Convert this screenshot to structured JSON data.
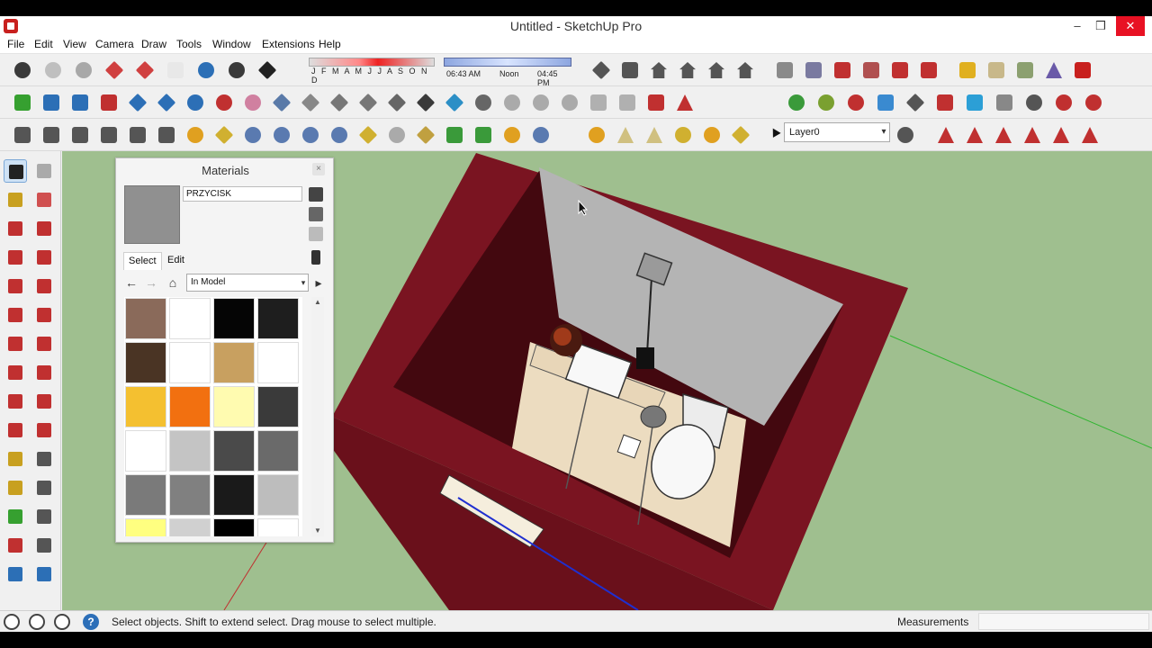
{
  "app": {
    "title": "Untitled - SketchUp Pro",
    "window_buttons": {
      "minimize": "–",
      "maximize": "❒",
      "close": "✕"
    },
    "accent_color": "#c8201e"
  },
  "menu": [
    "File",
    "Edit",
    "View",
    "Camera",
    "Draw",
    "Tools",
    "Window",
    "Extensions",
    "Help"
  ],
  "toolbar1": {
    "icons": [
      {
        "name": "get-started-icon",
        "color": "#3a3a3a",
        "shape": "circle"
      },
      {
        "name": "xray-icon",
        "color": "#bfbfbf",
        "shape": "circle"
      },
      {
        "name": "back-edges-icon",
        "color": "#a8a8a8",
        "shape": "circle"
      },
      {
        "name": "wireframe-icon",
        "color": "#d04040",
        "shape": "diamond"
      },
      {
        "name": "hidden-line-icon",
        "color": "#d04040",
        "shape": "diamond"
      },
      {
        "name": "shaded-icon",
        "color": "#e8e8e8",
        "shape": "square"
      },
      {
        "name": "shaded-with-textures-icon",
        "color": "#2c6fb6",
        "shape": "circle"
      },
      {
        "name": "monochrome-icon",
        "color": "#3a3a3a",
        "shape": "circle"
      },
      {
        "name": "shadows-icon",
        "color": "#222222",
        "shape": "diamond"
      }
    ],
    "shadow_months": "J F M A M J J A S O N D",
    "time_start": "06:43 AM",
    "time_mid": "Noon",
    "time_end": "04:45 PM",
    "view_icons": [
      {
        "name": "iso-view-icon",
        "color": "#555555",
        "shape": "diamond"
      },
      {
        "name": "top-view-icon",
        "color": "#555555",
        "shape": "square"
      },
      {
        "name": "front-view-icon",
        "color": "#555555",
        "shape": "house"
      },
      {
        "name": "right-view-icon",
        "color": "#555555",
        "shape": "house"
      },
      {
        "name": "back-view-icon",
        "color": "#555555",
        "shape": "house"
      },
      {
        "name": "left-view-icon",
        "color": "#555555",
        "shape": "house"
      }
    ],
    "section_icons": [
      {
        "name": "section-plane-icon",
        "color": "#8a8a8a",
        "shape": "square"
      },
      {
        "name": "display-section-planes-icon",
        "color": "#7a7aa0",
        "shape": "square"
      },
      {
        "name": "display-section-cuts-icon",
        "color": "#c03030",
        "shape": "square"
      },
      {
        "name": "section-fill-icon",
        "color": "#b05050",
        "shape": "square"
      },
      {
        "name": "section-cut-icon",
        "color": "#c03030",
        "shape": "square"
      },
      {
        "name": "section-grid-icon",
        "color": "#c03030",
        "shape": "square"
      }
    ],
    "right_icons": [
      {
        "name": "components-icon",
        "color": "#e0b020",
        "shape": "square"
      },
      {
        "name": "group-icon",
        "color": "#c8b88a",
        "shape": "square"
      },
      {
        "name": "outliner-icon",
        "color": "#8ca070",
        "shape": "square"
      },
      {
        "name": "warehouse-icon",
        "color": "#6a5aa8",
        "shape": "tri"
      },
      {
        "name": "extension-warehouse-icon",
        "color": "#c8201e",
        "shape": "square"
      }
    ]
  },
  "toolbar2": {
    "icons": [
      {
        "name": "layout-icon",
        "color": "#36a030",
        "shape": "square"
      },
      {
        "name": "push-pull-icon",
        "color": "#2c6fb6",
        "shape": "square"
      },
      {
        "name": "move-up-icon",
        "color": "#2c6fb6",
        "shape": "square"
      },
      {
        "name": "move-down-icon",
        "color": "#c03030",
        "shape": "square"
      },
      {
        "name": "follow-me-icon",
        "color": "#2c6fb6",
        "shape": "diamond"
      },
      {
        "name": "scale-icon",
        "color": "#2c6fb6",
        "shape": "diamond"
      },
      {
        "name": "undo-icon",
        "color": "#2c6fb6",
        "shape": "circle"
      },
      {
        "name": "redo-icon",
        "color": "#c03030",
        "shape": "circle"
      },
      {
        "name": "lasso-icon",
        "color": "#d080a0",
        "shape": "circle"
      },
      {
        "name": "face-style-1-icon",
        "color": "#5a7aa8",
        "shape": "diamond"
      },
      {
        "name": "face-style-2-icon",
        "color": "#888888",
        "shape": "diamond"
      },
      {
        "name": "face-style-3-icon",
        "color": "#777777",
        "shape": "diamond"
      },
      {
        "name": "face-style-4-icon",
        "color": "#777777",
        "shape": "diamond"
      },
      {
        "name": "face-style-5-icon",
        "color": "#666666",
        "shape": "diamond"
      },
      {
        "name": "face-style-6-icon",
        "color": "#3a3a3a",
        "shape": "diamond"
      },
      {
        "name": "face-style-7-icon",
        "color": "#2c8fc6",
        "shape": "diamond"
      },
      {
        "name": "sandbox-1-icon",
        "color": "#666666",
        "shape": "circle"
      },
      {
        "name": "sandbox-2-icon",
        "color": "#aaaaaa",
        "shape": "circle"
      },
      {
        "name": "sandbox-3-icon",
        "color": "#aaaaaa",
        "shape": "circle"
      },
      {
        "name": "sandbox-4-icon",
        "color": "#aaaaaa",
        "shape": "circle"
      },
      {
        "name": "sandbox-5-icon",
        "color": "#b0b0b0",
        "shape": "square"
      },
      {
        "name": "sandbox-6-icon",
        "color": "#b0b0b0",
        "shape": "square"
      },
      {
        "name": "delete-icon",
        "color": "#c03030",
        "shape": "square"
      },
      {
        "name": "mirror-icon",
        "color": "#c03030",
        "shape": "tri"
      },
      {
        "name": "plant-1-icon",
        "color": "#3a9a3a",
        "shape": "circle"
      },
      {
        "name": "plant-2-icon",
        "color": "#7aa030",
        "shape": "circle"
      },
      {
        "name": "plant-3-icon",
        "color": "#c03030",
        "shape": "circle"
      },
      {
        "name": "colors-icon",
        "color": "#3a8ad0",
        "shape": "square"
      },
      {
        "name": "paint-tool-icon",
        "color": "#555555",
        "shape": "diamond"
      },
      {
        "name": "solid-1-icon",
        "color": "#c03030",
        "shape": "square"
      },
      {
        "name": "solid-2-icon",
        "color": "#2c9fd6",
        "shape": "square"
      },
      {
        "name": "solid-3-icon",
        "color": "#888888",
        "shape": "square"
      },
      {
        "name": "target-icon",
        "color": "#555555",
        "shape": "circle"
      },
      {
        "name": "measure-icon",
        "color": "#c03030",
        "shape": "circle"
      },
      {
        "name": "target-2-icon",
        "color": "#c03030",
        "shape": "circle"
      }
    ]
  },
  "toolbar3": {
    "icons": [
      {
        "name": "style-1-icon",
        "color": "#555555",
        "shape": "square"
      },
      {
        "name": "style-2-icon",
        "color": "#555555",
        "shape": "square"
      },
      {
        "name": "style-3-icon",
        "color": "#555555",
        "shape": "square"
      },
      {
        "name": "style-4-icon",
        "color": "#555555",
        "shape": "square"
      },
      {
        "name": "style-5-icon",
        "color": "#555555",
        "shape": "square"
      },
      {
        "name": "style-6-icon",
        "color": "#555555",
        "shape": "square"
      },
      {
        "name": "plugin-m-icon",
        "color": "#e0a020",
        "shape": "circle"
      },
      {
        "name": "plugin-tag-icon",
        "color": "#d0b030",
        "shape": "diamond"
      },
      {
        "name": "plugin-r-icon",
        "color": "#5a7ab0",
        "shape": "circle"
      },
      {
        "name": "plugin-rt-icon",
        "color": "#5a7ab0",
        "shape": "circle"
      },
      {
        "name": "plugin-br-icon",
        "color": "#5a7ab0",
        "shape": "circle"
      },
      {
        "name": "plugin-help-icon",
        "color": "#5a7ab0",
        "shape": "circle"
      },
      {
        "name": "plugin-pencil-icon",
        "color": "#d0b030",
        "shape": "diamond"
      },
      {
        "name": "plugin-sphere-icon",
        "color": "#aaaaaa",
        "shape": "circle"
      },
      {
        "name": "plugin-sun-icon",
        "color": "#c0a040",
        "shape": "diamond"
      },
      {
        "name": "plugin-tree-1-icon",
        "color": "#3a9a3a",
        "shape": "square"
      },
      {
        "name": "plugin-tree-2-icon",
        "color": "#3a9a3a",
        "shape": "square"
      },
      {
        "name": "plugin-target-icon",
        "color": "#e0a020",
        "shape": "circle"
      },
      {
        "name": "plugin-pause-icon",
        "color": "#5a7ab0",
        "shape": "circle"
      },
      {
        "name": "light-1-icon",
        "color": "#e0a020",
        "shape": "circle"
      },
      {
        "name": "light-2-icon",
        "color": "#d0c080",
        "shape": "tri"
      },
      {
        "name": "light-3-icon",
        "color": "#d0c080",
        "shape": "tri"
      },
      {
        "name": "light-4-icon",
        "color": "#d0b030",
        "shape": "circle"
      },
      {
        "name": "light-5-icon",
        "color": "#e0a020",
        "shape": "circle"
      },
      {
        "name": "light-6-icon",
        "color": "#d0b030",
        "shape": "diamond"
      }
    ],
    "layer_value": "Layer0",
    "arrow_icons": [
      {
        "name": "arrow-aj-icon",
        "color": "#c03030",
        "shape": "tri"
      },
      {
        "name": "arrow-ar-icon",
        "color": "#c03030",
        "shape": "tri"
      },
      {
        "name": "arrow-av-icon",
        "color": "#c03030",
        "shape": "tri"
      },
      {
        "name": "arrow-an-icon",
        "color": "#c03030",
        "shape": "tri"
      },
      {
        "name": "arrow-ax-icon",
        "color": "#c03030",
        "shape": "tri"
      },
      {
        "name": "arrow-af-icon",
        "color": "#c03030",
        "shape": "tri"
      }
    ]
  },
  "left_tools": [
    {
      "name": "select-tool-icon",
      "color": "#222222",
      "selected": true
    },
    {
      "name": "make-component-icon",
      "color": "#aaaaaa"
    },
    {
      "name": "paint-bucket-icon",
      "color": "#c8a020"
    },
    {
      "name": "eraser-icon",
      "color": "#d05050"
    },
    {
      "name": "line-tool-icon",
      "color": "#c03030"
    },
    {
      "name": "freehand-tool-icon",
      "color": "#c03030"
    },
    {
      "name": "rectangle-tool-icon",
      "color": "#c03030"
    },
    {
      "name": "rotated-rectangle-icon",
      "color": "#c03030"
    },
    {
      "name": "circle-tool-icon",
      "color": "#c03030"
    },
    {
      "name": "polygon-tool-icon",
      "color": "#c03030"
    },
    {
      "name": "arc-tool-icon",
      "color": "#c03030"
    },
    {
      "name": "two-point-arc-icon",
      "color": "#c03030"
    },
    {
      "name": "three-point-arc-icon",
      "color": "#c03030"
    },
    {
      "name": "pie-tool-icon",
      "color": "#c03030"
    },
    {
      "name": "move-tool-icon",
      "color": "#c03030"
    },
    {
      "name": "push-pull-tool-icon",
      "color": "#c03030"
    },
    {
      "name": "rotate-tool-icon",
      "color": "#c03030"
    },
    {
      "name": "follow-me-tool-icon",
      "color": "#c03030"
    },
    {
      "name": "scale-tool-icon",
      "color": "#c03030"
    },
    {
      "name": "offset-tool-icon",
      "color": "#c03030"
    },
    {
      "name": "tape-measure-icon",
      "color": "#c8a020"
    },
    {
      "name": "dimension-tool-icon",
      "color": "#555555"
    },
    {
      "name": "protractor-icon",
      "color": "#c8a020"
    },
    {
      "name": "text-tool-icon",
      "color": "#555555"
    },
    {
      "name": "axes-tool-icon",
      "color": "#36a030"
    },
    {
      "name": "3d-text-icon",
      "color": "#555555"
    },
    {
      "name": "orbit-tool-icon",
      "color": "#c03030"
    },
    {
      "name": "pan-tool-icon",
      "color": "#555555"
    },
    {
      "name": "zoom-tool-icon",
      "color": "#2c6fb6"
    },
    {
      "name": "zoom-window-icon",
      "color": "#2c6fb6"
    }
  ],
  "materials": {
    "title": "Materials",
    "close": "×",
    "name": "PRZYCISK",
    "swatch_color": "#909090",
    "tabs": {
      "select": "Select",
      "edit": "Edit"
    },
    "nav": {
      "back": "←",
      "forward": "→",
      "home": "⌂",
      "details": "▸"
    },
    "collection": "In Model",
    "dropdown_arrow": "▾",
    "scroll_up": "▲",
    "scroll_down": "▼",
    "swatches": [
      "#8a6a5a",
      "#ffffff",
      "#050505",
      "#1e1e1e",
      "#4a3424",
      "#ffffff",
      "#c8a060",
      "#ffffff",
      "#f4c030",
      "#f27010",
      "#fffbb0",
      "#3a3a3a",
      "#ffffff",
      "#c4c4c4",
      "#4a4a4a",
      "#6a6a6a",
      "#7a7a7a",
      "#808080",
      "#1a1a1a",
      "#bdbdbd",
      "#ffff80",
      "#d0d0d0",
      "#000000",
      "#ffffff"
    ]
  },
  "status": {
    "hint": "Select objects. Shift to extend select. Drag mouse to select multiple.",
    "measurements_label": "Measurements",
    "help": "?"
  }
}
